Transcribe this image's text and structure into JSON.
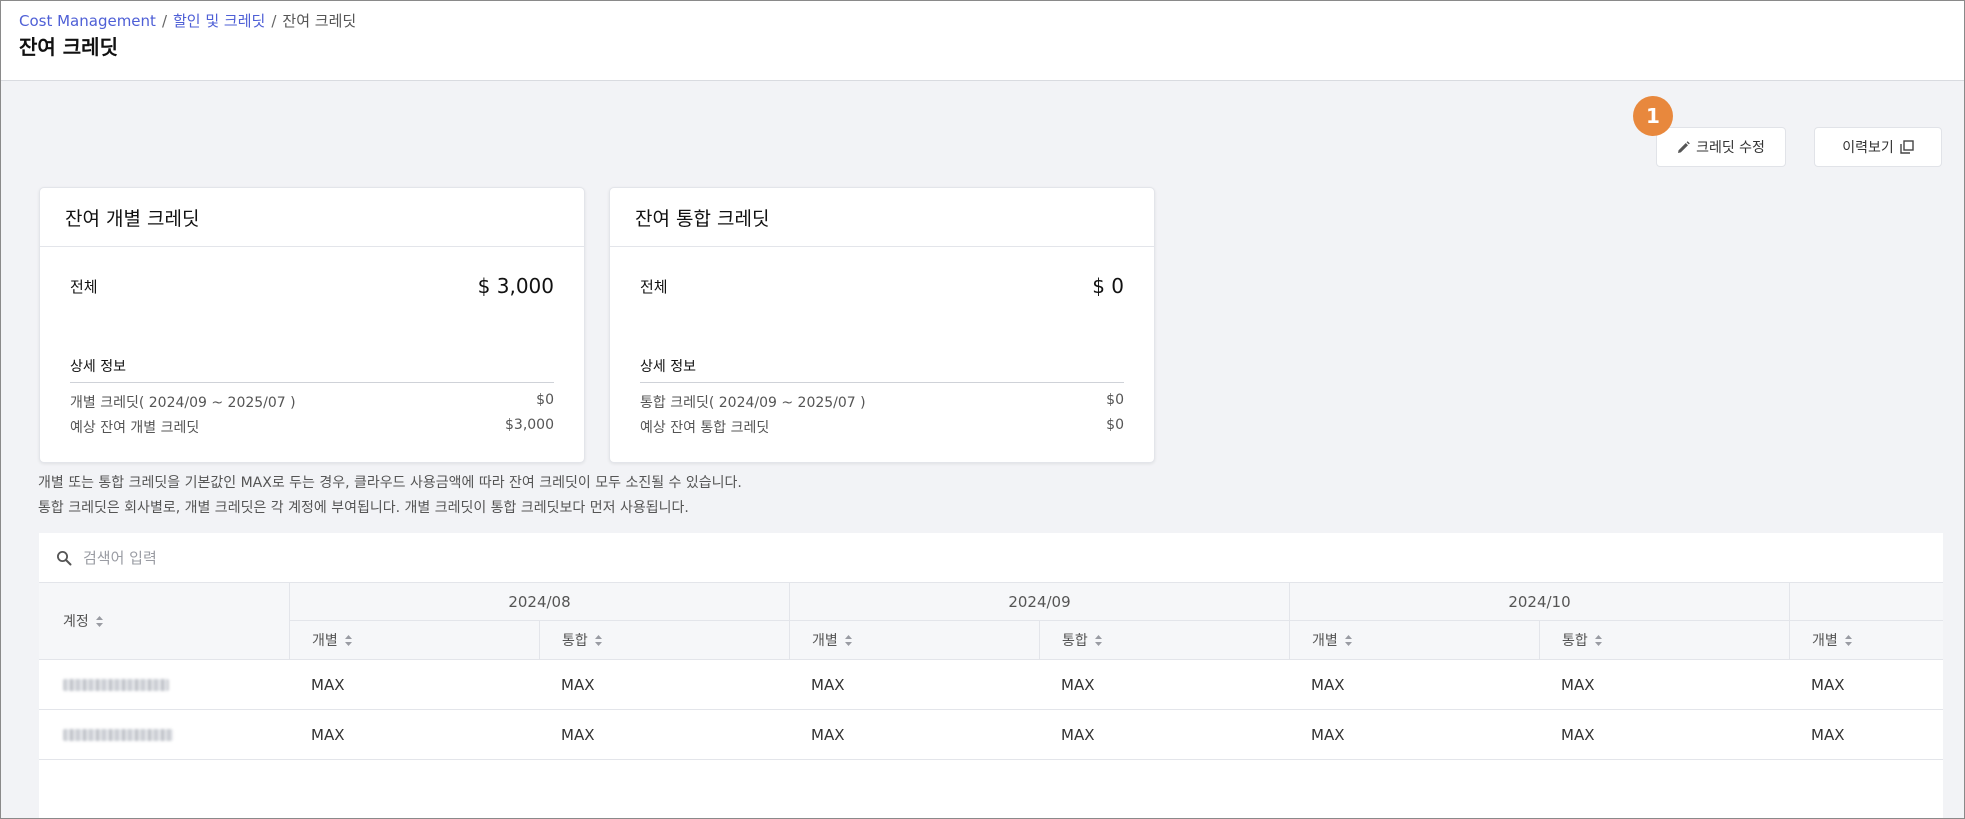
{
  "breadcrumb": {
    "items": [
      "Cost Management",
      "할인 및 크레딧",
      "잔여 크레딧"
    ],
    "separator": "/"
  },
  "page_title": "잔여 크레딧",
  "actions": {
    "edit_label": "크레딧 수정",
    "history_label": "이력보기",
    "step_badge": "1"
  },
  "cards": {
    "individual": {
      "title": "잔여 개별 크레딧",
      "total_label": "전체",
      "total_value": "$ 3,000",
      "detail_title": "상세 정보",
      "rows": [
        {
          "label": "개별 크레딧( 2024/09 ~ 2025/07 )",
          "value": "$0"
        },
        {
          "label": "예상 잔여 개별 크레딧",
          "value": "$3,000"
        }
      ]
    },
    "integrated": {
      "title": "잔여 통합 크레딧",
      "total_label": "전체",
      "total_value": "$ 0",
      "detail_title": "상세 정보",
      "rows": [
        {
          "label": "통합 크레딧( 2024/09 ~ 2025/07 )",
          "value": "$0"
        },
        {
          "label": "예상 잔여 통합 크레딧",
          "value": "$0"
        }
      ]
    }
  },
  "notes": [
    "개별 또는 통합 크레딧을 기본값인 MAX로 두는 경우, 클라우드 사용금액에 따라 잔여 크레딧이 모두 소진될 수 있습니다.",
    "통합 크레딧은 회사별로, 개별 크레딧은 각 계정에 부여됩니다. 개별 크레딧이 통합 크레딧보다 먼저 사용됩니다."
  ],
  "search": {
    "placeholder": "검색어 입력",
    "value": ""
  },
  "table": {
    "account_header": "계정",
    "months": [
      "2024/08",
      "2024/09",
      "2024/10",
      ""
    ],
    "sub_headers": [
      "개별",
      "통합",
      "개별",
      "통합",
      "개별",
      "통합",
      "개별"
    ],
    "rows": [
      {
        "cells": [
          "MAX",
          "MAX",
          "MAX",
          "MAX",
          "MAX",
          "MAX",
          "MAX"
        ]
      },
      {
        "cells": [
          "MAX",
          "MAX",
          "MAX",
          "MAX",
          "MAX",
          "MAX",
          "MAX"
        ]
      }
    ]
  },
  "colors": {
    "link": "#4e5fd6",
    "badge": "#e8883d",
    "background": "#f2f3f6"
  }
}
